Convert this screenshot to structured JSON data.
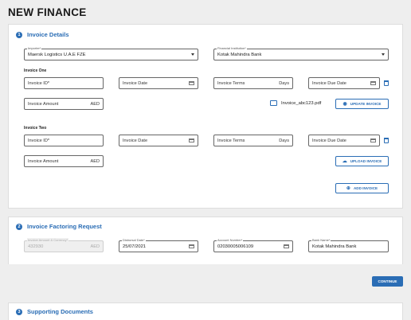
{
  "page": {
    "title": "NEW FINANCE"
  },
  "colors": {
    "accent": "#2a6db5",
    "background": "#eeeeee"
  },
  "invoice_details": {
    "number": "1",
    "title": "Invoice Details",
    "importer": {
      "label": "Importer*",
      "value": "Maersk Logistics U.A.E FZE"
    },
    "financial_institution": {
      "label": "Financial Institution*",
      "value": "Kotak Mahindra Bank"
    },
    "invoice_one": {
      "label": "Invoice One",
      "invoice_id": "Invoice ID*",
      "invoice_date": "Invoice Date",
      "invoice_terms": "Invoice Terms",
      "terms_suffix": "Days",
      "invoice_due_date": "Invoice Due Date",
      "invoice_amount": "Invoice Amount",
      "amount_suffix": "AED",
      "file_name": "Invoice_abc123.pdf",
      "update_button": "UPDATE INVOICE"
    },
    "invoice_two": {
      "label": "Invoice Two",
      "invoice_id": "Invoice ID*",
      "invoice_date": "Invoice Date",
      "invoice_terms": "Invoice Terms",
      "terms_suffix": "Days",
      "invoice_due_date": "Invoice Due Date",
      "invoice_amount": "Invoice Amount",
      "amount_suffix": "AED",
      "upload_button": "UPLOAD INVOICE"
    },
    "add_invoice_button": "ADD INVOICE"
  },
  "factoring": {
    "number": "2",
    "title": "Invoice Factoring Request",
    "invoice_amount": {
      "label": "Invoice Amount & Currency*",
      "value": "432930",
      "suffix": "AED"
    },
    "disbursal_date": {
      "label": "Disbursal Date*",
      "value": "25/07/2021"
    },
    "account_number": {
      "label": "Account Number*",
      "value": "02030005006109"
    },
    "bank_name": {
      "label": "Bank Name*",
      "value": "Kotak Mahindra Bank"
    }
  },
  "continue_button": "CONTINUE",
  "supporting": {
    "number": "3",
    "title": "Supporting Documents"
  }
}
